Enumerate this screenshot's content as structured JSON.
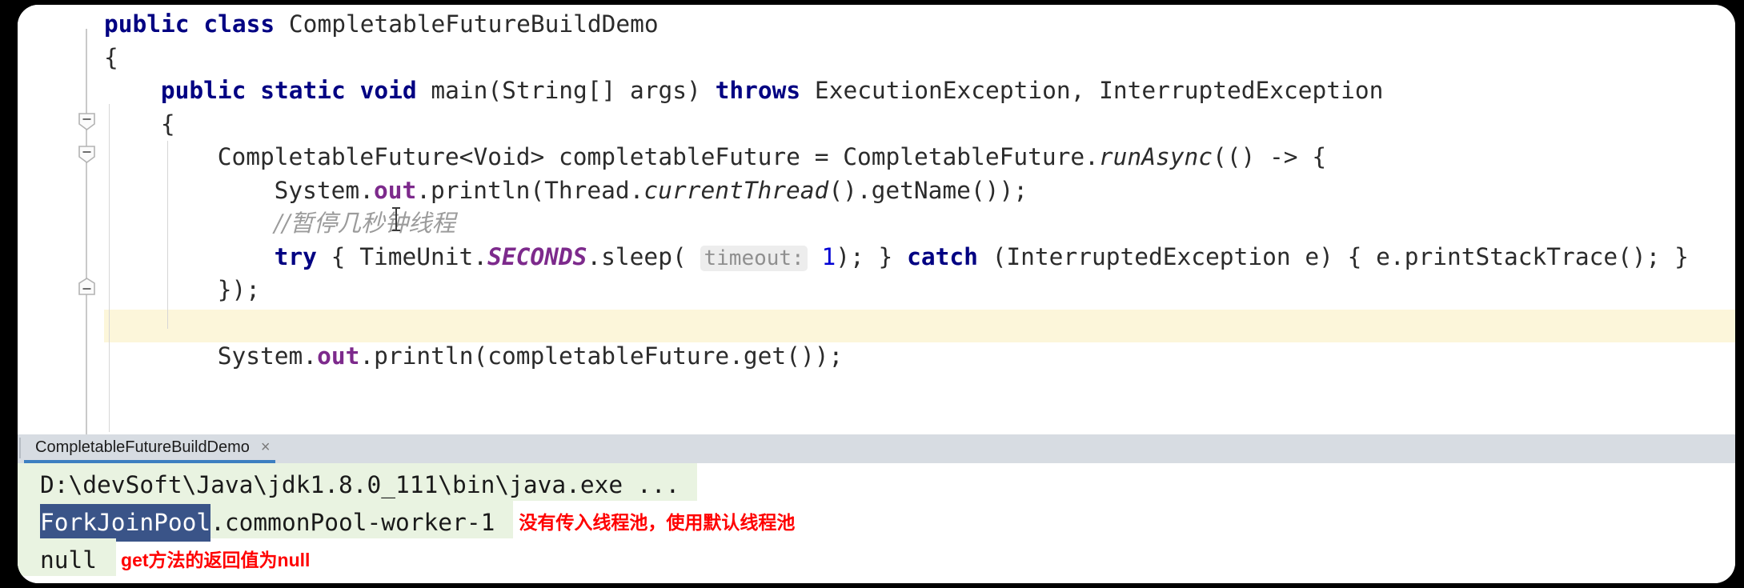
{
  "app": {
    "type": "java-ide-editor-with-console"
  },
  "editor": {
    "language": "java",
    "caret_line_index": 9,
    "lines": [
      {
        "indent": 0,
        "tokens": [
          {
            "t": "public",
            "c": "kw"
          },
          {
            "t": " ",
            "c": "plain"
          },
          {
            "t": "class",
            "c": "kw"
          },
          {
            "t": " CompletableFutureBuildDemo",
            "c": "plain"
          }
        ]
      },
      {
        "indent": 0,
        "tokens": [
          {
            "t": "{",
            "c": "plain"
          }
        ]
      },
      {
        "indent": 1,
        "tokens": [
          {
            "t": "public",
            "c": "kw"
          },
          {
            "t": " ",
            "c": "plain"
          },
          {
            "t": "static",
            "c": "kw"
          },
          {
            "t": " ",
            "c": "plain"
          },
          {
            "t": "void",
            "c": "kw"
          },
          {
            "t": " main(String[] args) ",
            "c": "plain"
          },
          {
            "t": "throws",
            "c": "kw"
          },
          {
            "t": " ExecutionException, InterruptedException",
            "c": "plain"
          }
        ]
      },
      {
        "indent": 1,
        "tokens": [
          {
            "t": "{",
            "c": "plain"
          }
        ]
      },
      {
        "indent": 2,
        "tokens": [
          {
            "t": "CompletableFuture<Void> completableFuture = CompletableFuture.",
            "c": "plain"
          },
          {
            "t": "runAsync",
            "c": "ital"
          },
          {
            "t": "(() -> {",
            "c": "plain"
          }
        ]
      },
      {
        "indent": 3,
        "tokens": [
          {
            "t": "System.",
            "c": "plain"
          },
          {
            "t": "out",
            "c": "statf"
          },
          {
            "t": ".println(Thread.",
            "c": "plain"
          },
          {
            "t": "currentThread",
            "c": "ital"
          },
          {
            "t": "().getName());",
            "c": "plain"
          }
        ]
      },
      {
        "indent": 3,
        "tokens": [
          {
            "t": "//暂停几秒钟线程",
            "c": "cmt"
          }
        ]
      },
      {
        "indent": 3,
        "tokens": [
          {
            "t": "try",
            "c": "kw"
          },
          {
            "t": " { TimeUnit.",
            "c": "plain"
          },
          {
            "t": "SECONDS",
            "c": "stat"
          },
          {
            "t": ".sleep( ",
            "c": "plain"
          },
          {
            "t": "timeout:",
            "c": "hint"
          },
          {
            "t": " ",
            "c": "plain"
          },
          {
            "t": "1",
            "c": "num"
          },
          {
            "t": "); } ",
            "c": "plain"
          },
          {
            "t": "catch",
            "c": "kw"
          },
          {
            "t": " (InterruptedException e) { e.printStackTrace(); }",
            "c": "plain"
          }
        ]
      },
      {
        "indent": 2,
        "tokens": [
          {
            "t": "});",
            "c": "plain"
          }
        ]
      },
      {
        "indent": 0,
        "tokens": []
      },
      {
        "indent": 2,
        "tokens": [
          {
            "t": "System.",
            "c": "plain"
          },
          {
            "t": "out",
            "c": "statf"
          },
          {
            "t": ".println(completableFuture.get());",
            "c": "plain"
          }
        ]
      }
    ],
    "fold_markers": [
      {
        "line": 3,
        "glyph": "minus-collapse-icon"
      },
      {
        "line": 4,
        "glyph": "minus-collapse-icon"
      },
      {
        "line": 8,
        "glyph": "minus-collapse-end-icon"
      }
    ]
  },
  "run_panel": {
    "tab": {
      "label": "CompletableFutureBuildDemo",
      "close_glyph": "×"
    },
    "console": {
      "lines": [
        {
          "segments": [
            {
              "text": "D:\\devSoft\\Java\\jdk1.8.0_111\\bin\\java.exe ...",
              "style": "cmd"
            }
          ],
          "annotation": ""
        },
        {
          "segments": [
            {
              "text": "ForkJoinPool",
              "style": "selected"
            },
            {
              "text": ".commonPool-worker-1",
              "style": "plain"
            }
          ],
          "annotation": "没有传入线程池，使用默认线程池"
        },
        {
          "segments": [
            {
              "text": "null",
              "style": "plain"
            }
          ],
          "annotation": "get方法的返回值为null"
        }
      ]
    }
  },
  "colors": {
    "keyword": "#000082",
    "static_field": "#7d2a8c",
    "comment": "#9b9b9b",
    "number": "#0000d4",
    "caret_line": "#fcf6da",
    "console_bg_tint": "#e9f3e1",
    "selection": "#3a5488",
    "annotation": "#ff0000",
    "tab_accent": "#3d7fc1",
    "tabstrip": "#d7dce2"
  }
}
